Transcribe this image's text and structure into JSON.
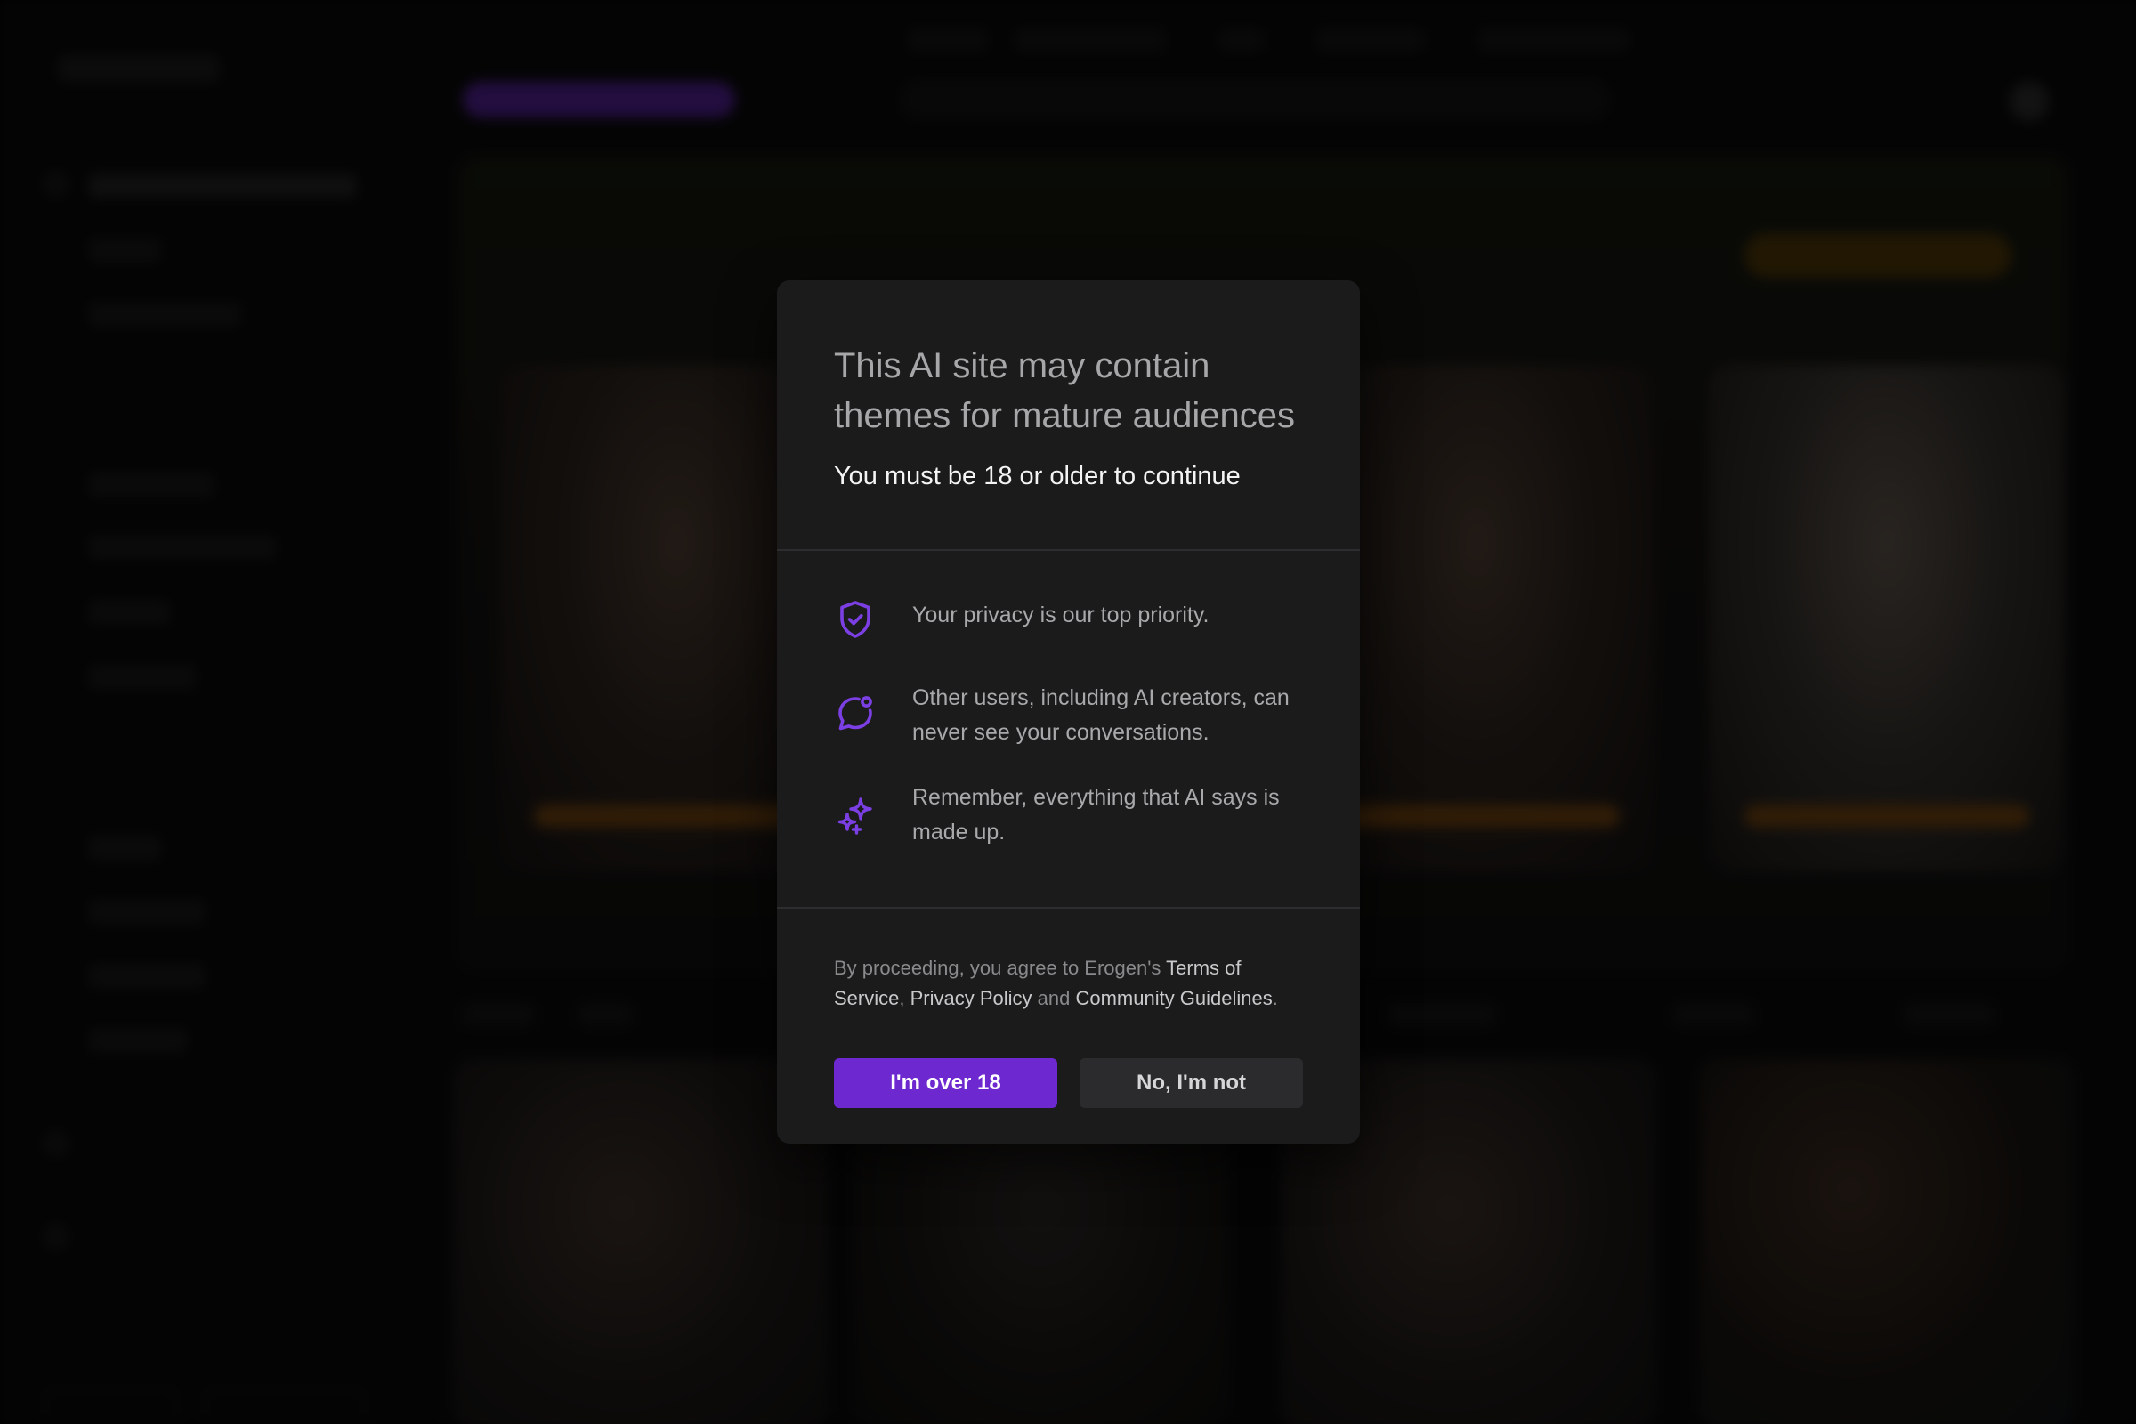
{
  "modal": {
    "title": "This AI site may contain themes for mature audiences",
    "subtitle": "You must be 18 or older to continue",
    "features": [
      {
        "icon": "shield-check-icon",
        "text": "Your privacy is our top priority."
      },
      {
        "icon": "chat-bubble-notification-icon",
        "text": "Other users, including AI creators, can never see your conversations."
      },
      {
        "icon": "sparkles-icon",
        "text": "Remember, everything that AI says is made up."
      }
    ],
    "legal": {
      "prefix": "By proceeding, you agree to Erogen's ",
      "terms": "Terms of Service",
      "sep1": ", ",
      "privacy": "Privacy Policy",
      "sep2": " and ",
      "guidelines": "Community Guidelines",
      "suffix": "."
    },
    "buttons": {
      "confirm": "I'm over 18",
      "decline": "No, I'm not"
    }
  },
  "colors": {
    "accent": "#6d28d0",
    "icon": "#7b3fe4",
    "modal_bg": "#1b1b1c",
    "overlay": "rgba(0,0,0,0.55)"
  }
}
